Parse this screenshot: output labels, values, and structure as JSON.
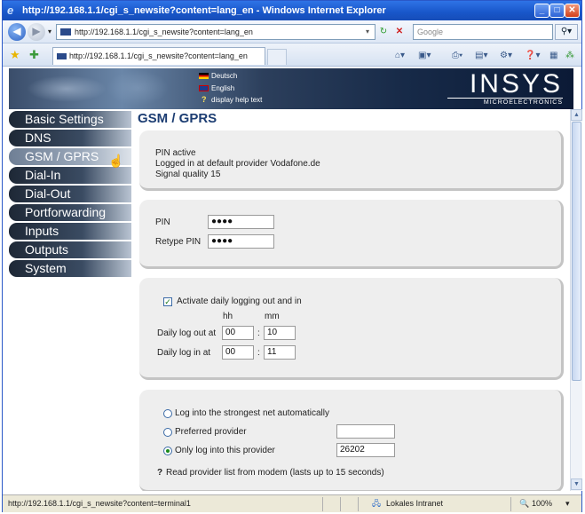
{
  "window": {
    "title": "http://192.168.1.1/cgi_s_newsite?content=lang_en - Windows Internet Explorer"
  },
  "address": {
    "url": "http://192.168.1.1/cgi_s_newsite?content=lang_en",
    "search_placeholder": "Google"
  },
  "tab": {
    "label": "http://192.168.1.1/cgi_s_newsite?content=lang_en"
  },
  "header": {
    "languages": [
      "Deutsch",
      "English"
    ],
    "help": "display help text",
    "logo": "INSYS",
    "logo_sub": "MICROELECTRONICS"
  },
  "nav": [
    "Basic Settings",
    "DNS",
    "GSM / GPRS",
    "Dial-In",
    "Dial-Out",
    "Portforwarding",
    "Inputs",
    "Outputs",
    "System"
  ],
  "page": {
    "title": "GSM / GPRS"
  },
  "status_box": {
    "line1": "PIN active",
    "line2": "Logged in at default provider Vodafone.de",
    "line3": "Signal quality 15"
  },
  "pin": {
    "pin_label": "PIN",
    "pin_value": "●●●●",
    "retype_label": "Retype PIN",
    "retype_value": "●●●●"
  },
  "logging": {
    "checkbox_label": "Activate daily logging out and in",
    "hh": "hh",
    "mm": "mm",
    "logout_label": "Daily log out at",
    "logout_hh": "00",
    "logout_mm": "10",
    "login_label": "Daily log in at",
    "login_hh": "00",
    "login_mm": "11",
    "separator": ":"
  },
  "provider": {
    "opt1": "Log into the strongest net automatically",
    "opt2": "Preferred provider",
    "opt2_value": "",
    "opt3": "Only log into this provider",
    "opt3_value": "26202",
    "read_link": "Read provider list from modem (lasts up to 15 seconds)"
  },
  "statusbar": {
    "url": "http://192.168.1.1/cgi_s_newsite?content=terminal1",
    "zone": "Lokales Intranet",
    "zoom": "100%"
  }
}
